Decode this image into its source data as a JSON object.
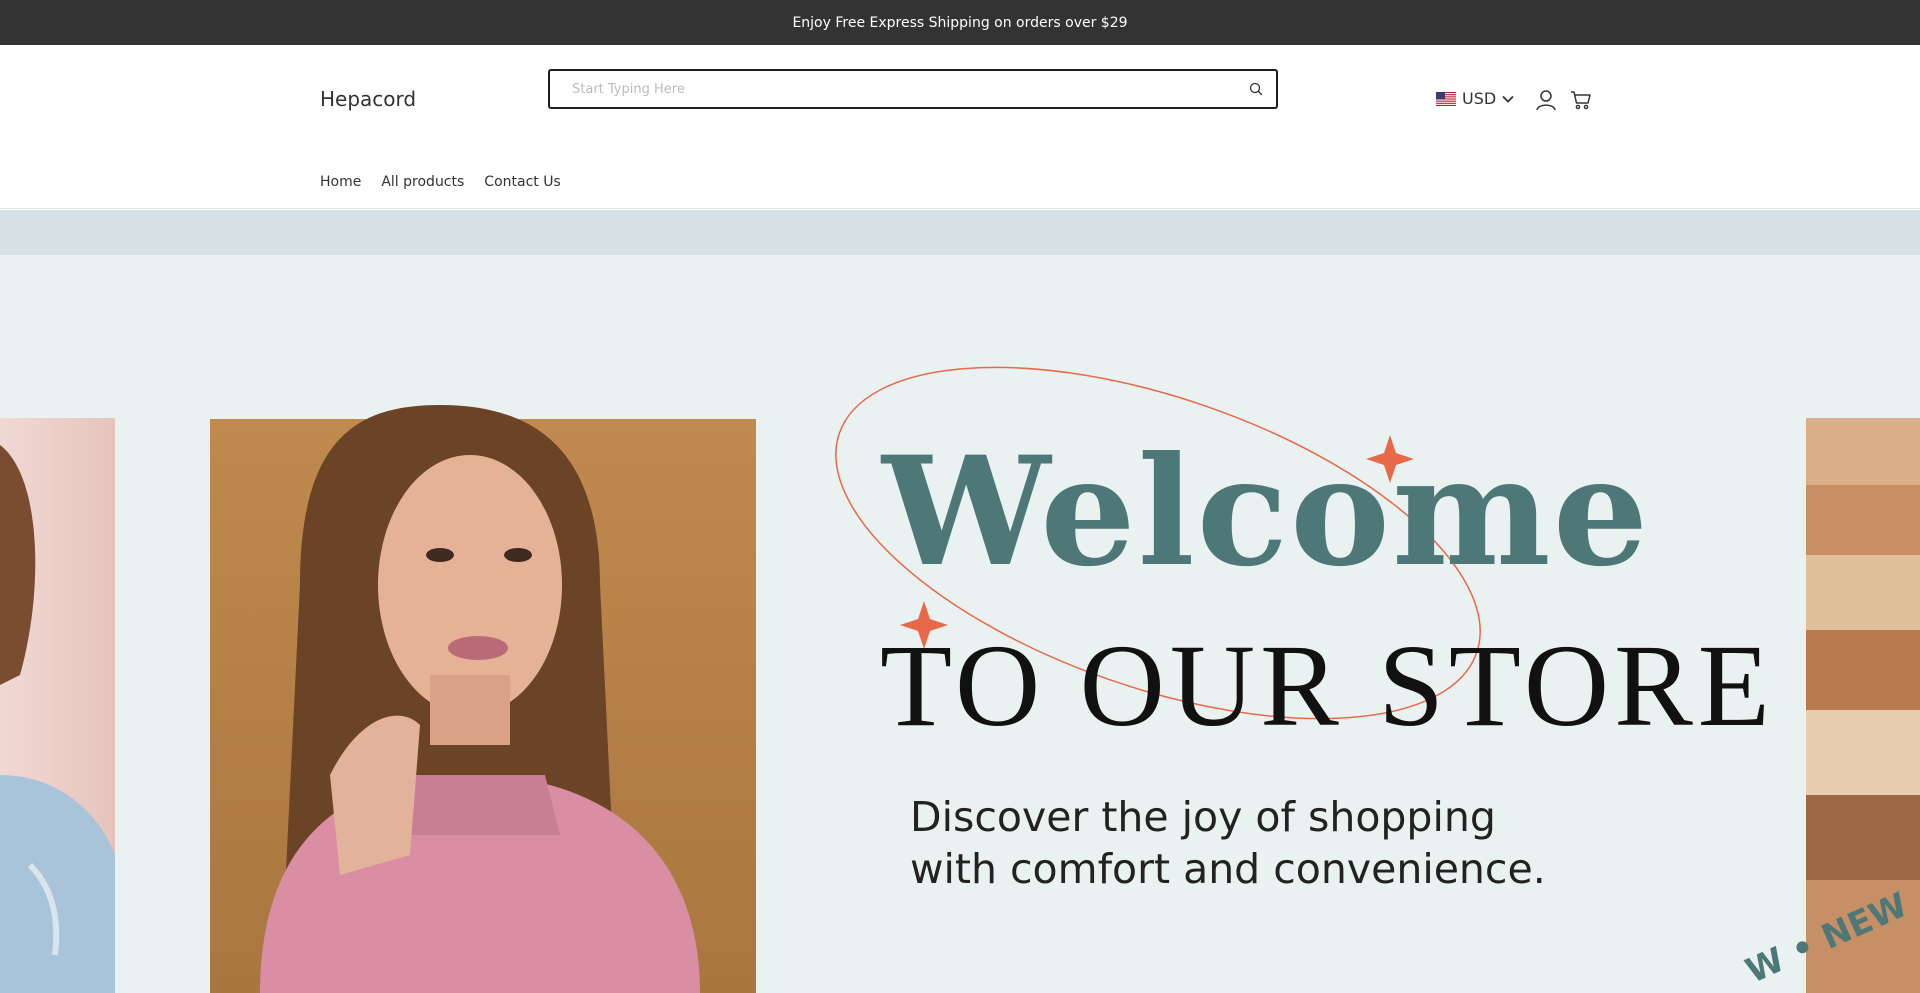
{
  "announcement": {
    "text": "Enjoy Free Express Shipping on orders over $29"
  },
  "header": {
    "logo": "Hepacord",
    "search": {
      "placeholder": "Start Typing Here",
      "value": "",
      "icon": "search-icon"
    },
    "currency": {
      "label": "USD",
      "flag": "us-flag-icon"
    },
    "icons": [
      "user-icon",
      "cart-icon"
    ]
  },
  "nav": {
    "items": [
      {
        "label": "Home"
      },
      {
        "label": "All products"
      },
      {
        "label": "Contact Us"
      }
    ]
  },
  "hero": {
    "title_line1": "Welcome",
    "title_line2": "TO OUR STORE",
    "tagline": "Discover the joy of shopping with comfort and convenience.",
    "badge_text": "W • NEW",
    "colors": {
      "background": "#eaf2f1",
      "accent_teal": "#4e7878",
      "accent_orange": "#e8694a"
    }
  },
  "colors": {
    "announcement_bg": "#333333",
    "strip_bg": "#d6e2e5"
  }
}
